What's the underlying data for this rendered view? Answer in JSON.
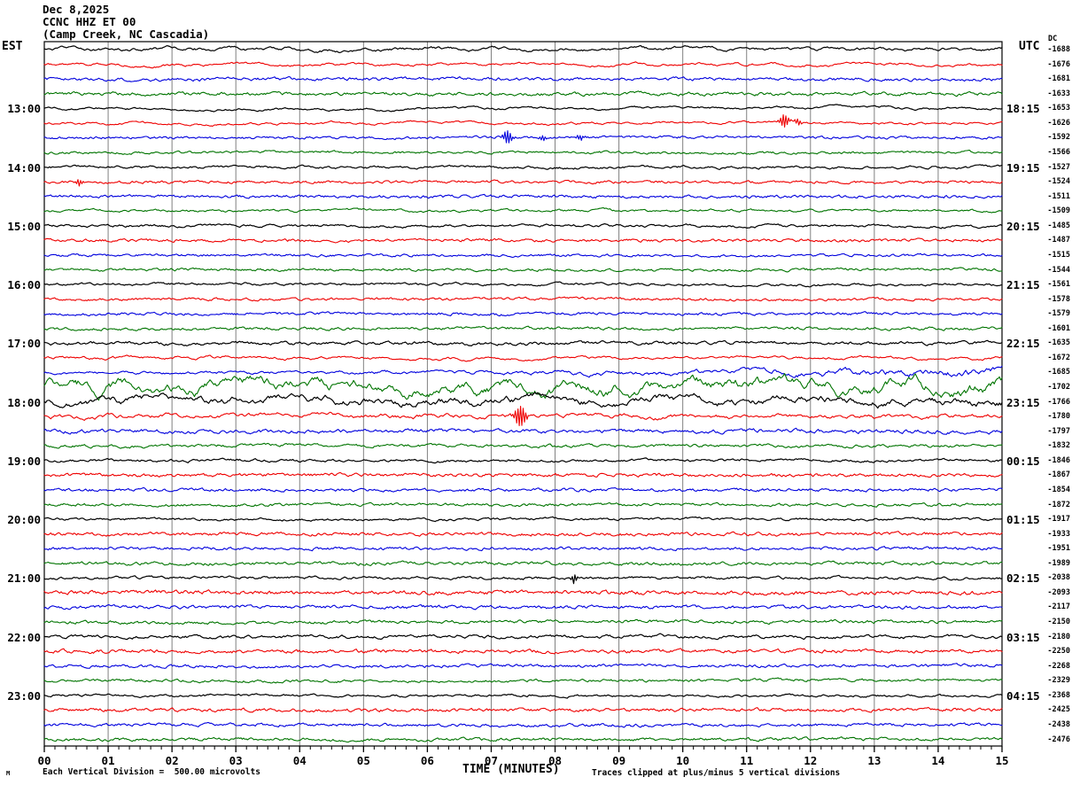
{
  "header": {
    "date": "Dec 8,2025",
    "station": "CCNC HHZ ET 00",
    "location": "(Camp Creek, NC Cascadia)"
  },
  "axes": {
    "left_label": "EST",
    "right_label": "UTC",
    "dc_header": "DC",
    "xlabel": "TIME (MINUTES)",
    "x_ticks": [
      "00",
      "01",
      "02",
      "03",
      "04",
      "05",
      "06",
      "07",
      "08",
      "09",
      "10",
      "11",
      "12",
      "13",
      "14",
      "15"
    ],
    "x_range_minutes": [
      0,
      15
    ],
    "minor_ticks_per_minute": 6
  },
  "footer": {
    "scale_note": "Each Vertical Division =  500.00 microvolts",
    "clip_note": "Traces clipped at plus/minus 5 vertical divisions",
    "m_glyph": "M"
  },
  "colors": {
    "black": "#000000",
    "red": "#ee0000",
    "blue": "#0000dd",
    "green": "#007400",
    "grid": "#808080",
    "border": "#000000"
  },
  "chart_data": {
    "type": "line",
    "subtype": "webicorder-seismogram",
    "title": "Dec 8,2025 CCNC HHZ ET 00 (Camp Creek, NC Cascadia)",
    "xlabel": "TIME (MINUTES)",
    "x_ticks": [
      "00",
      "01",
      "02",
      "03",
      "04",
      "05",
      "06",
      "07",
      "08",
      "09",
      "10",
      "11",
      "12",
      "13",
      "14",
      "15"
    ],
    "left_axis": "EST",
    "right_axis": "UTC",
    "grid": "vertical-minute-lines",
    "traces_note": "48 fifteen-minute traces, color cycle black/red/blue/green, amp = approx peak amplitude in px, sm = smoothness, env = amplitude envelope across the row, ev = spike events [minute, amplitude_px, width_min]",
    "traces": [
      {
        "c": "black",
        "est": "",
        "utc": "",
        "dc": -1688,
        "amp": 4.5,
        "sm": 0.9,
        "env": [
          1,
          1,
          1,
          1
        ],
        "ev": []
      },
      {
        "c": "red",
        "est": "",
        "utc": "",
        "dc": -1676,
        "amp": 4.0,
        "sm": 0.88,
        "env": [
          1,
          1,
          1,
          1
        ],
        "ev": []
      },
      {
        "c": "blue",
        "est": "",
        "utc": "",
        "dc": -1681,
        "amp": 3.0,
        "sm": 0.65,
        "env": [
          1,
          1,
          1,
          1
        ],
        "ev": []
      },
      {
        "c": "green",
        "est": "",
        "utc": "",
        "dc": -1633,
        "amp": 3.0,
        "sm": 0.7,
        "env": [
          1,
          1,
          1,
          1
        ],
        "ev": []
      },
      {
        "c": "black",
        "est": "13:00",
        "utc": "18:15",
        "dc": -1653,
        "amp": 4.5,
        "sm": 0.9,
        "env": [
          1,
          1,
          1,
          1
        ],
        "ev": []
      },
      {
        "c": "red",
        "est": "",
        "utc": "",
        "dc": -1626,
        "amp": 3.5,
        "sm": 0.85,
        "env": [
          1,
          1,
          1,
          1
        ],
        "ev": [
          [
            11.6,
            9,
            0.1
          ],
          [
            11.82,
            8,
            0.08
          ]
        ]
      },
      {
        "c": "blue",
        "est": "",
        "utc": "",
        "dc": -1592,
        "amp": 2.5,
        "sm": 0.6,
        "env": [
          1,
          1,
          1,
          1
        ],
        "ev": [
          [
            7.25,
            8,
            0.1
          ],
          [
            7.8,
            5,
            0.07
          ],
          [
            8.35,
            9,
            0.1
          ]
        ]
      },
      {
        "c": "green",
        "est": "",
        "utc": "",
        "dc": -1566,
        "amp": 2.5,
        "sm": 0.65,
        "env": [
          1,
          1,
          1,
          1
        ],
        "ev": []
      },
      {
        "c": "black",
        "est": "14:00",
        "utc": "19:15",
        "dc": -1527,
        "amp": 2.8,
        "sm": 0.8,
        "env": [
          1,
          1,
          1,
          1
        ],
        "ev": []
      },
      {
        "c": "red",
        "est": "",
        "utc": "",
        "dc": -1524,
        "amp": 2.5,
        "sm": 0.6,
        "env": [
          1,
          1,
          1,
          1
        ],
        "ev": [
          [
            0.55,
            8,
            0.07
          ]
        ]
      },
      {
        "c": "blue",
        "est": "",
        "utc": "",
        "dc": -1511,
        "amp": 2.5,
        "sm": 0.6,
        "env": [
          1,
          1,
          1,
          1
        ],
        "ev": []
      },
      {
        "c": "green",
        "est": "",
        "utc": "",
        "dc": -1509,
        "amp": 3.8,
        "sm": 0.8,
        "env": [
          1,
          1,
          1,
          1
        ],
        "ev": []
      },
      {
        "c": "black",
        "est": "15:00",
        "utc": "20:15",
        "dc": -1485,
        "amp": 3.0,
        "sm": 0.8,
        "env": [
          1,
          1,
          1,
          1
        ],
        "ev": []
      },
      {
        "c": "red",
        "est": "",
        "utc": "",
        "dc": -1487,
        "amp": 2.6,
        "sm": 0.6,
        "env": [
          1,
          1,
          1,
          1
        ],
        "ev": []
      },
      {
        "c": "blue",
        "est": "",
        "utc": "",
        "dc": -1515,
        "amp": 2.5,
        "sm": 0.6,
        "env": [
          1,
          1,
          1,
          1
        ],
        "ev": []
      },
      {
        "c": "green",
        "est": "",
        "utc": "",
        "dc": -1544,
        "amp": 2.6,
        "sm": 0.65,
        "env": [
          1,
          1,
          1,
          1
        ],
        "ev": []
      },
      {
        "c": "black",
        "est": "16:00",
        "utc": "21:15",
        "dc": -1561,
        "amp": 3.0,
        "sm": 0.8,
        "env": [
          1,
          1,
          1,
          1
        ],
        "ev": []
      },
      {
        "c": "red",
        "est": "",
        "utc": "",
        "dc": -1578,
        "amp": 2.6,
        "sm": 0.6,
        "env": [
          1,
          1,
          1,
          1
        ],
        "ev": []
      },
      {
        "c": "blue",
        "est": "",
        "utc": "",
        "dc": -1579,
        "amp": 2.6,
        "sm": 0.6,
        "env": [
          1,
          1,
          1,
          1
        ],
        "ev": []
      },
      {
        "c": "green",
        "est": "",
        "utc": "",
        "dc": -1601,
        "amp": 2.6,
        "sm": 0.65,
        "env": [
          1,
          1,
          1,
          1
        ],
        "ev": []
      },
      {
        "c": "black",
        "est": "17:00",
        "utc": "22:15",
        "dc": -1635,
        "amp": 3.0,
        "sm": 0.75,
        "env": [
          1,
          1,
          1,
          1
        ],
        "ev": []
      },
      {
        "c": "red",
        "est": "",
        "utc": "",
        "dc": -1672,
        "amp": 4.2,
        "sm": 0.88,
        "env": [
          1.15,
          1,
          0.9,
          1
        ],
        "ev": []
      },
      {
        "c": "blue",
        "est": "",
        "utc": "",
        "dc": -1685,
        "amp": 4.5,
        "sm": 0.85,
        "env": [
          0.7,
          0.9,
          1.3,
          2.0
        ],
        "ev": []
      },
      {
        "c": "green",
        "est": "",
        "utc": "",
        "dc": -1702,
        "amp": 15.0,
        "sm": 0.94,
        "env": [
          1.05,
          0.95,
          1,
          1.1
        ],
        "ev": []
      },
      {
        "c": "black",
        "est": "18:00",
        "utc": "23:15",
        "dc": -1766,
        "amp": 10.5,
        "sm": 0.93,
        "env": [
          1,
          1,
          1,
          1
        ],
        "ev": []
      },
      {
        "c": "red",
        "est": "",
        "utc": "",
        "dc": -1780,
        "amp": 5.0,
        "sm": 0.87,
        "env": [
          1,
          1,
          1,
          1
        ],
        "ev": [
          [
            7.45,
            11,
            0.13
          ]
        ]
      },
      {
        "c": "blue",
        "est": "",
        "utc": "",
        "dc": -1797,
        "amp": 3.6,
        "sm": 0.7,
        "env": [
          1,
          1,
          1,
          1
        ],
        "ev": []
      },
      {
        "c": "green",
        "est": "",
        "utc": "",
        "dc": -1832,
        "amp": 3.0,
        "sm": 0.7,
        "env": [
          1,
          1,
          1,
          1
        ],
        "ev": []
      },
      {
        "c": "black",
        "est": "19:00",
        "utc": "00:15",
        "dc": -1846,
        "amp": 3.0,
        "sm": 0.75,
        "env": [
          1,
          1,
          1,
          1
        ],
        "ev": []
      },
      {
        "c": "red",
        "est": "",
        "utc": "",
        "dc": -1867,
        "amp": 2.8,
        "sm": 0.6,
        "env": [
          1,
          1,
          1,
          1
        ],
        "ev": []
      },
      {
        "c": "blue",
        "est": "",
        "utc": "",
        "dc": -1854,
        "amp": 2.6,
        "sm": 0.6,
        "env": [
          1,
          1,
          1,
          1
        ],
        "ev": []
      },
      {
        "c": "green",
        "est": "",
        "utc": "",
        "dc": -1872,
        "amp": 2.8,
        "sm": 0.65,
        "env": [
          1,
          1,
          1,
          1
        ],
        "ev": []
      },
      {
        "c": "black",
        "est": "20:00",
        "utc": "01:15",
        "dc": -1917,
        "amp": 2.8,
        "sm": 0.72,
        "env": [
          1,
          1,
          1,
          1
        ],
        "ev": []
      },
      {
        "c": "red",
        "est": "",
        "utc": "",
        "dc": -1933,
        "amp": 3.0,
        "sm": 0.6,
        "env": [
          1,
          1,
          1,
          1
        ],
        "ev": []
      },
      {
        "c": "blue",
        "est": "",
        "utc": "",
        "dc": -1951,
        "amp": 2.6,
        "sm": 0.6,
        "env": [
          1,
          1,
          1,
          1
        ],
        "ev": []
      },
      {
        "c": "green",
        "est": "",
        "utc": "",
        "dc": -1989,
        "amp": 2.8,
        "sm": 0.65,
        "env": [
          1,
          1,
          1,
          1
        ],
        "ev": []
      },
      {
        "c": "black",
        "est": "21:00",
        "utc": "02:15",
        "dc": -2038,
        "amp": 3.0,
        "sm": 0.72,
        "env": [
          1,
          1,
          1,
          1
        ],
        "ev": [
          [
            8.3,
            5,
            0.06
          ]
        ]
      },
      {
        "c": "red",
        "est": "",
        "utc": "",
        "dc": -2093,
        "amp": 3.2,
        "sm": 0.6,
        "env": [
          1,
          1,
          1,
          1
        ],
        "ev": []
      },
      {
        "c": "blue",
        "est": "",
        "utc": "",
        "dc": -2117,
        "amp": 3.0,
        "sm": 0.62,
        "env": [
          1,
          1,
          1,
          1
        ],
        "ev": []
      },
      {
        "c": "green",
        "est": "",
        "utc": "",
        "dc": -2150,
        "amp": 3.0,
        "sm": 0.65,
        "env": [
          1,
          1,
          1,
          1
        ],
        "ev": []
      },
      {
        "c": "black",
        "est": "22:00",
        "utc": "03:15",
        "dc": -2180,
        "amp": 3.5,
        "sm": 0.78,
        "env": [
          1,
          1,
          1,
          1
        ],
        "ev": []
      },
      {
        "c": "red",
        "est": "",
        "utc": "",
        "dc": -2250,
        "amp": 3.2,
        "sm": 0.6,
        "env": [
          1,
          1,
          1,
          1
        ],
        "ev": []
      },
      {
        "c": "blue",
        "est": "",
        "utc": "",
        "dc": -2268,
        "amp": 3.0,
        "sm": 0.62,
        "env": [
          1,
          1,
          1,
          1
        ],
        "ev": []
      },
      {
        "c": "green",
        "est": "",
        "utc": "",
        "dc": -2329,
        "amp": 3.2,
        "sm": 0.65,
        "env": [
          1,
          1,
          1,
          1
        ],
        "ev": []
      },
      {
        "c": "black",
        "est": "23:00",
        "utc": "04:15",
        "dc": -2368,
        "amp": 3.2,
        "sm": 0.75,
        "env": [
          1,
          1,
          1,
          1
        ],
        "ev": []
      },
      {
        "c": "red",
        "est": "",
        "utc": "",
        "dc": -2425,
        "amp": 3.0,
        "sm": 0.6,
        "env": [
          1,
          1,
          1,
          1
        ],
        "ev": []
      },
      {
        "c": "blue",
        "est": "",
        "utc": "",
        "dc": -2438,
        "amp": 3.0,
        "sm": 0.62,
        "env": [
          1,
          1,
          1,
          1
        ],
        "ev": []
      },
      {
        "c": "green",
        "est": "",
        "utc": "",
        "dc": -2476,
        "amp": 3.0,
        "sm": 0.65,
        "env": [
          1,
          1,
          1,
          1
        ],
        "ev": []
      }
    ]
  }
}
